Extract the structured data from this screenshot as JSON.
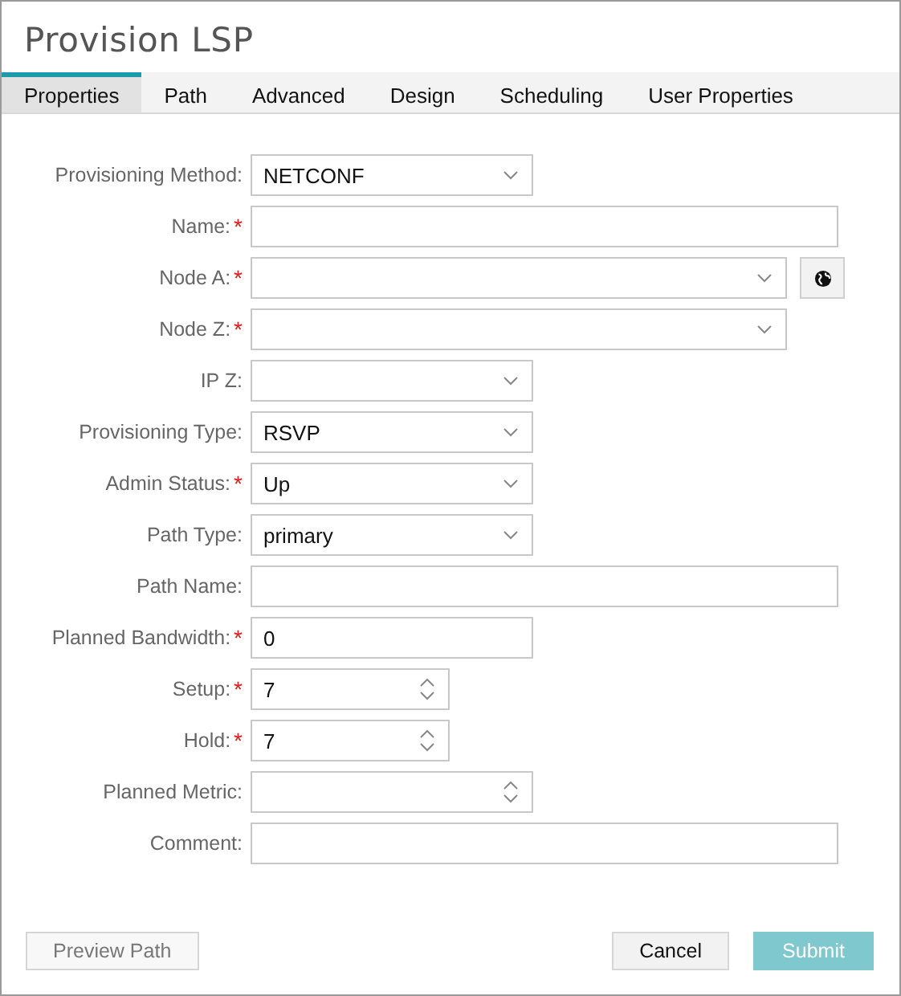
{
  "window": {
    "title": "Provision LSP"
  },
  "tabs": [
    {
      "label": "Properties",
      "selected": true
    },
    {
      "label": "Path",
      "selected": false
    },
    {
      "label": "Advanced",
      "selected": false
    },
    {
      "label": "Design",
      "selected": false
    },
    {
      "label": "Scheduling",
      "selected": false
    },
    {
      "label": "User Properties",
      "selected": false
    }
  ],
  "fields": [
    {
      "label": "Provisioning Method:",
      "required": false,
      "kind": "select",
      "wide": false,
      "value": "NETCONF"
    },
    {
      "label": "Name:",
      "required": true,
      "kind": "text",
      "wide": true
    },
    {
      "label": "Node A:",
      "required": true,
      "kind": "node",
      "wide": true
    },
    {
      "label": "Node Z:",
      "required": true,
      "kind": "select",
      "wide": true
    },
    {
      "label": "IP Z:",
      "required": false,
      "kind": "select",
      "wide": false
    },
    {
      "label": "Provisioning Type:",
      "required": false,
      "kind": "select",
      "wide": false,
      "value": "RSVP"
    },
    {
      "label": "Admin Status:",
      "required": true,
      "kind": "select",
      "wide": false,
      "value": "Up"
    },
    {
      "label": "Path Type:",
      "required": false,
      "kind": "select",
      "wide": false,
      "value": "primary"
    },
    {
      "label": "Path Name:",
      "required": false,
      "kind": "text",
      "wide": true
    },
    {
      "label": "Planned Bandwidth:",
      "required": true,
      "kind": "text",
      "wide": false,
      "value": "0"
    },
    {
      "label": "Setup:",
      "required": true,
      "kind": "spinner",
      "wide": false,
      "value": "7"
    },
    {
      "label": "Hold:",
      "required": true,
      "kind": "spinner",
      "wide": false,
      "value": "7"
    },
    {
      "label": "Planned Metric:",
      "required": false,
      "kind": "spinner",
      "wide": true
    },
    {
      "label": "Comment:",
      "required": false,
      "kind": "text",
      "wide": true
    }
  ],
  "required_mark": "*",
  "buttons": [
    {
      "label": "Preview Path",
      "kind": "plain",
      "disabled": true
    },
    {
      "label": "Cancel",
      "kind": "plain",
      "disabled": false
    },
    {
      "label": "Submit",
      "kind": "primary",
      "disabled": true
    }
  ]
}
